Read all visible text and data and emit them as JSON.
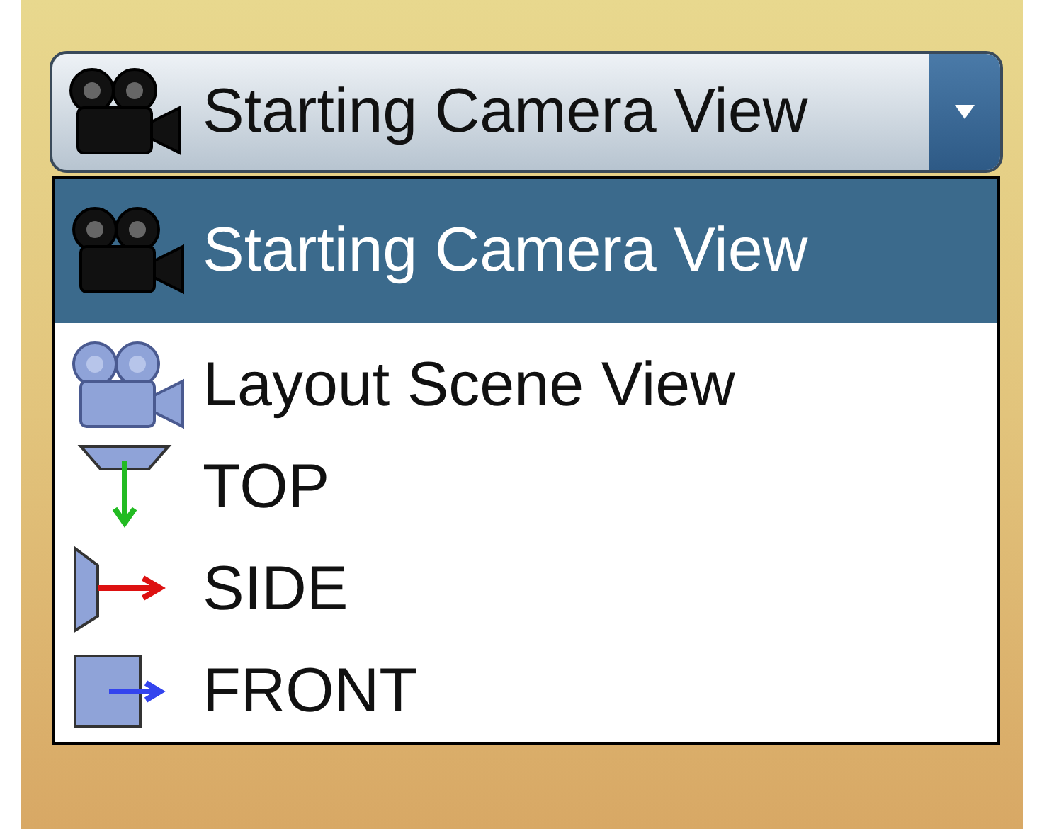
{
  "combo": {
    "value": "Starting Camera View",
    "kind": "camera"
  },
  "options": [
    {
      "label": "Starting Camera View",
      "kind": "camera",
      "selected": true
    },
    {
      "label": "Layout Scene View",
      "kind": "scene-camera",
      "selected": false
    },
    {
      "label": "TOP",
      "kind": "top",
      "selected": false
    },
    {
      "label": "SIDE",
      "kind": "side",
      "selected": false
    },
    {
      "label": "FRONT",
      "kind": "front",
      "selected": false
    }
  ]
}
